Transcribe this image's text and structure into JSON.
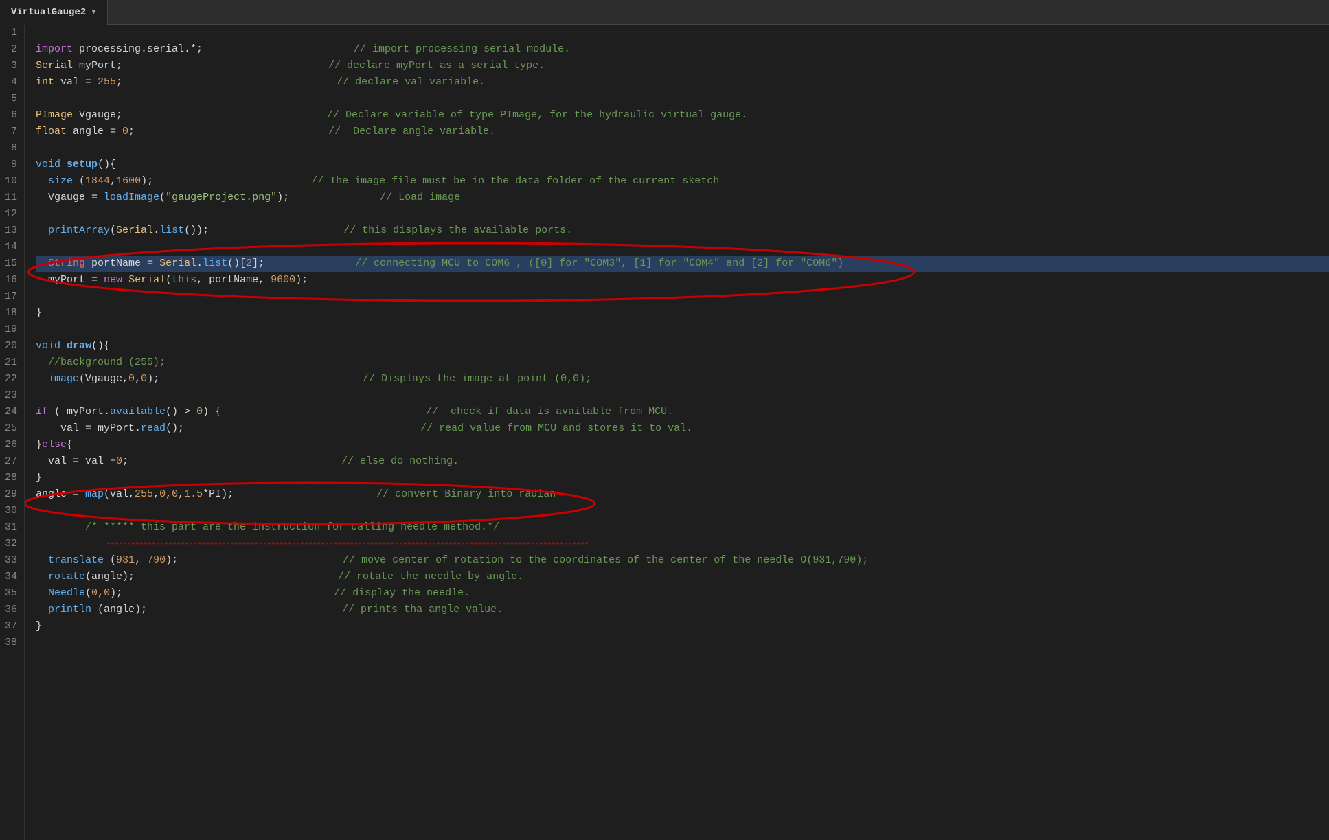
{
  "tab": {
    "title": "VirtualGauge2",
    "arrow": "▼"
  },
  "lines": [
    {
      "num": "1",
      "content": "",
      "tokens": []
    },
    {
      "num": "2",
      "raw": "import processing.serial.*;                         // import processing serial module."
    },
    {
      "num": "3",
      "raw": "Serial myPort;                                      // declare myPort as a serial type."
    },
    {
      "num": "4",
      "raw": "int val = 255;                                       // declare val variable."
    },
    {
      "num": "5",
      "raw": ""
    },
    {
      "num": "6",
      "raw": "PImage Vgauge;                                       // Declare variable of type PImage, for the hydraulic virtual gauge."
    },
    {
      "num": "7",
      "raw": "float angle = 0;                                     //  Declare angle variable."
    },
    {
      "num": "8",
      "raw": ""
    },
    {
      "num": "9",
      "raw": "void setup(){"
    },
    {
      "num": "10",
      "raw": "  size (1844,1600);                                  // The image file must be in the data folder of the current sketch"
    },
    {
      "num": "11",
      "raw": "  Vgauge = loadImage(\"gaugeProject.png\");            // Load image"
    },
    {
      "num": "12",
      "raw": ""
    },
    {
      "num": "13",
      "raw": "  printArray(Serial.list());                         // this displays the available ports."
    },
    {
      "num": "14",
      "raw": ""
    },
    {
      "num": "15",
      "raw": "  String portName = Serial.list()[2];                // connecting MCU to COM6 , ([0] for \"COM3\", [1] for \"COM4\" and [2] for \"COM6\")"
    },
    {
      "num": "16",
      "raw": "  myPort = new Serial(this, portName, 9600);"
    },
    {
      "num": "17",
      "raw": ""
    },
    {
      "num": "18",
      "raw": "}"
    },
    {
      "num": "19",
      "raw": ""
    },
    {
      "num": "20",
      "raw": "void draw(){"
    },
    {
      "num": "21",
      "raw": "  //background (255);"
    },
    {
      "num": "22",
      "raw": "  image(Vgauge,0,0);                                 // Displays the image at point (0,0);"
    },
    {
      "num": "23",
      "raw": ""
    },
    {
      "num": "24",
      "raw": "if ( myPort.available() > 0) {                            //  check if data is available from MCU."
    },
    {
      "num": "25",
      "raw": "    val = myPort.read();                                   // read value from MCU and stores it to val."
    },
    {
      "num": "26",
      "raw": "}else{"
    },
    {
      "num": "27",
      "raw": "  val = val +0;                                       // else do nothing."
    },
    {
      "num": "28",
      "raw": "}"
    },
    {
      "num": "29",
      "raw": "angle = map(val,255,0,0,1.5*PI);                     // convert Binary into radian"
    },
    {
      "num": "30",
      "raw": ""
    },
    {
      "num": "31",
      "raw": "        /* ***** this part are the instruction for calling needle method.*/"
    },
    {
      "num": "32",
      "raw": ""
    },
    {
      "num": "33",
      "raw": "  translate (931, 790);                              // move center of rotation to the coordinates of the center of the needle O(931,790);"
    },
    {
      "num": "34",
      "raw": "  rotate(angle);                                     // rotate the needle by angle."
    },
    {
      "num": "35",
      "raw": "  Needle(0,0);                                       // display the needle."
    },
    {
      "num": "36",
      "raw": "  println (angle);                                   // prints tha angle value."
    },
    {
      "num": "37",
      "raw": "}"
    },
    {
      "num": "38",
      "raw": ""
    }
  ]
}
